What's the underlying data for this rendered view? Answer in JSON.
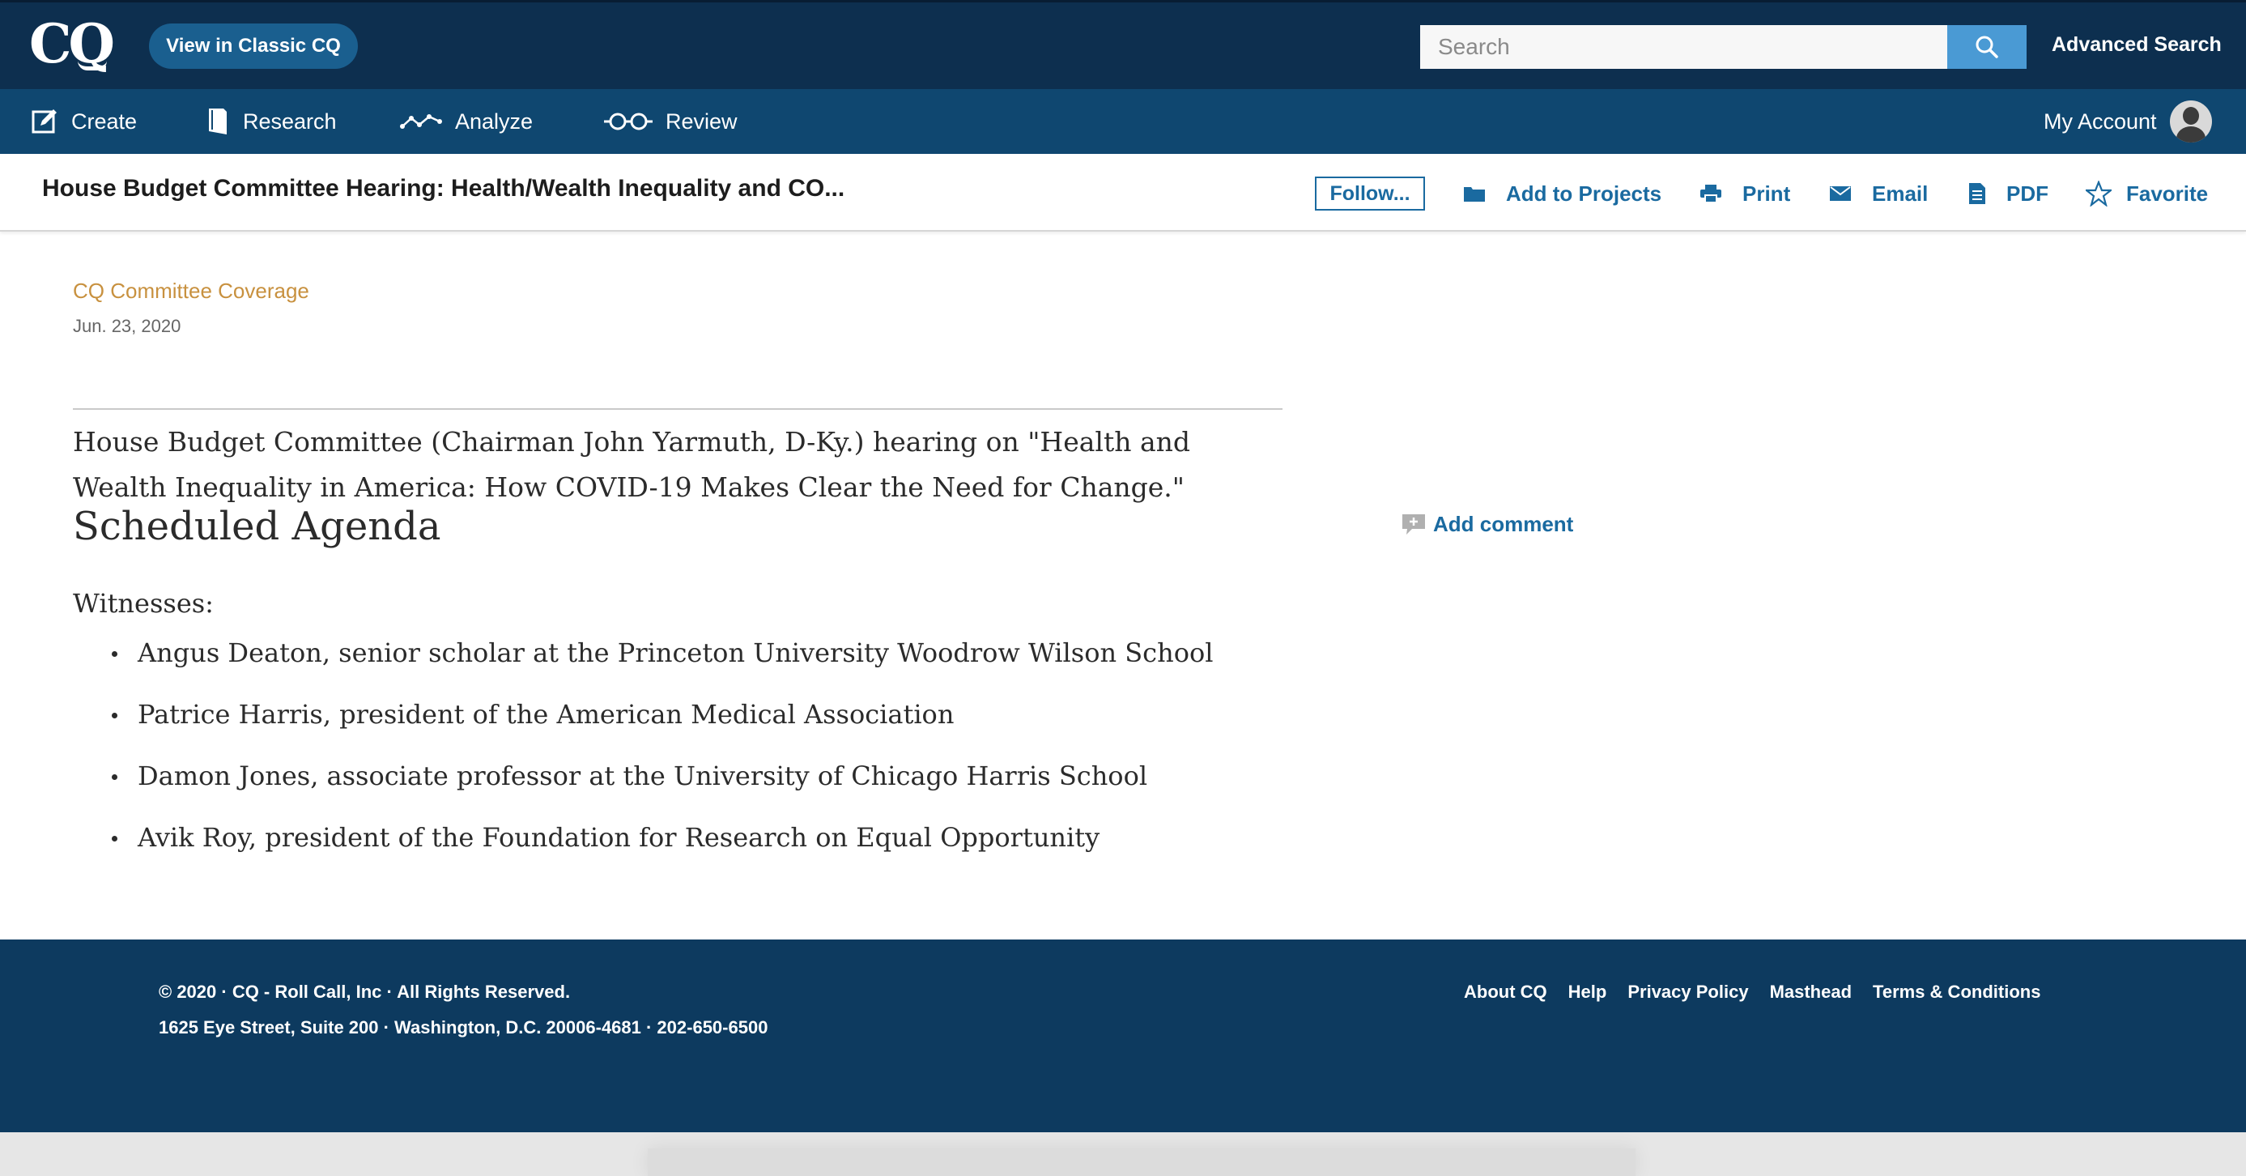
{
  "header": {
    "logo": "CQ",
    "classic_button": "View in Classic CQ",
    "search_placeholder": "Search",
    "advanced_search": "Advanced Search"
  },
  "nav": {
    "items": [
      {
        "label": "Create",
        "icon": "edit-icon"
      },
      {
        "label": "Research",
        "icon": "book-icon"
      },
      {
        "label": "Analyze",
        "icon": "line-chart-icon"
      },
      {
        "label": "Review",
        "icon": "glasses-icon"
      }
    ],
    "account": "My Account"
  },
  "toolbar": {
    "title": "House Budget Committee Hearing: Health/Wealth Inequality and CO...",
    "follow": "Follow...",
    "actions": [
      {
        "label": "Add to Projects",
        "icon": "folder-icon"
      },
      {
        "label": "Print",
        "icon": "printer-icon"
      },
      {
        "label": "Email",
        "icon": "envelope-icon"
      },
      {
        "label": "PDF",
        "icon": "document-icon"
      },
      {
        "label": "Favorite",
        "icon": "star-icon"
      }
    ]
  },
  "article": {
    "source": "CQ Committee Coverage",
    "date": "Jun. 23, 2020",
    "summary": "House Budget Committee (Chairman John Yarmuth, D-Ky.) hearing on \"Health and Wealth Inequality in America: How COVID-19 Makes Clear the Need for Change.\"",
    "agenda_heading": "Scheduled Agenda",
    "witnesses_label": "Witnesses:",
    "witnesses": [
      "Angus Deaton, senior scholar at the Princeton University Woodrow Wilson School",
      "Patrice Harris, president of the American Medical Association",
      "Damon Jones, associate professor at the University of Chicago Harris School",
      "Avik Roy, president of the Foundation for Research on Equal Opportunity"
    ]
  },
  "sidebar": {
    "add_comment": "Add comment"
  },
  "footer": {
    "copyright": "© 2020 · CQ - Roll Call, Inc · All Rights Reserved.",
    "address": "1625 Eye Street, Suite 200 · Washington, D.C. 20006-4681 · 202-650-6500",
    "links": [
      "About CQ",
      "Help",
      "Privacy Policy",
      "Masthead",
      "Terms & Conditions"
    ]
  },
  "colors": {
    "header_bg": "#0d2f4f",
    "nav_bg": "#0f4770",
    "accent": "#1a6aa0",
    "source_color": "#c8913f",
    "footer_bg": "#0d3a5f"
  }
}
